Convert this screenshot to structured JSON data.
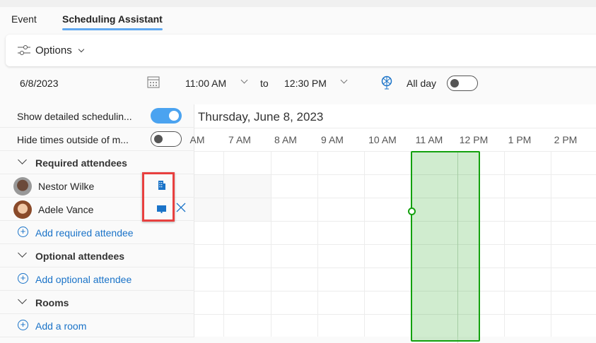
{
  "tabs": [
    {
      "label": "Event"
    },
    {
      "label": "Scheduling Assistant"
    }
  ],
  "options": {
    "label": "Options"
  },
  "date_row": {
    "date": "6/8/2023",
    "start": "11:00 AM",
    "to": "to",
    "end": "12:30 PM",
    "all_day": "All day",
    "all_day_on": false
  },
  "toggles": {
    "detailed": {
      "label": "Show detailed schedulin...",
      "on": true
    },
    "hide": {
      "label": "Hide times outside of m...",
      "on": false
    }
  },
  "grid": {
    "date_title": "Thursday, June 8, 2023",
    "hours": [
      "AM",
      "7 AM",
      "8 AM",
      "9 AM",
      "10 AM",
      "11 AM",
      "12 PM",
      "1 PM",
      "2 PM"
    ],
    "selection": {
      "start": "11:00 AM",
      "end": "12:30 PM"
    },
    "accent": "#13a10e"
  },
  "required": {
    "title": "Required attendees",
    "attendees": [
      {
        "name": "Nestor Wilke",
        "status_icon": "building-icon"
      },
      {
        "name": "Adele Vance",
        "status_icon": "monitor-icon"
      }
    ],
    "add": "Add required attendee"
  },
  "optional": {
    "title": "Optional attendees",
    "add": "Add optional attendee"
  },
  "rooms": {
    "title": "Rooms",
    "add": "Add a room"
  }
}
